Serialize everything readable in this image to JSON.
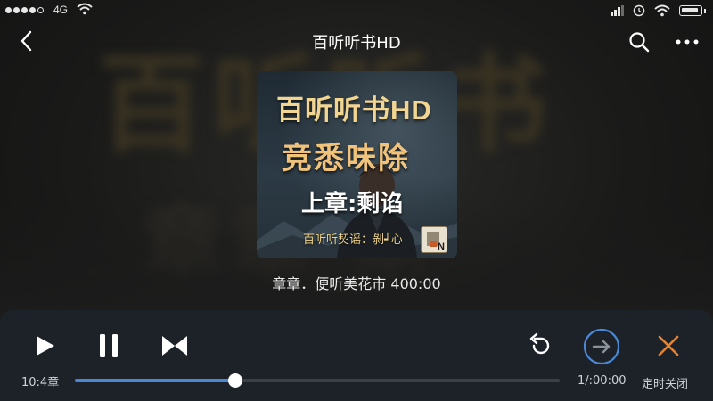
{
  "status_bar": {
    "network": "4G"
  },
  "nav": {
    "title": "百听听书HD",
    "back_icon": "chevron-left-icon",
    "search_icon": "search-icon",
    "more_icon": "more-dots-icon"
  },
  "background": {
    "blur_text_1": "百听听书",
    "blur_text_2": "章章  斯"
  },
  "cover": {
    "brand": "百听听书",
    "brand_hd": "HD",
    "headline": "竞悉味除",
    "chapter": "上章:剩谄",
    "caption": "百听听契谣：剝┙心",
    "badge_letter": "N"
  },
  "track_info": "章章．便听美花市 400:00",
  "player": {
    "current_time": "10:4章",
    "total_time": "1/:00:00",
    "timer_label": "定时关闭",
    "progress": 0.33,
    "accent_color": "#4a88d6"
  }
}
